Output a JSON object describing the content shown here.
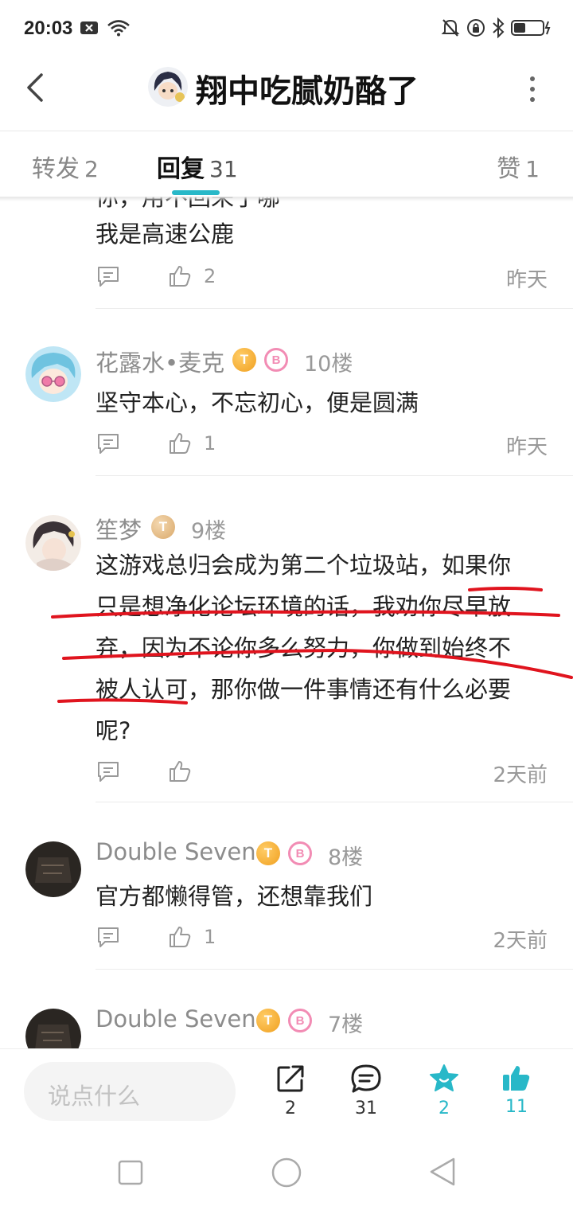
{
  "status": {
    "time": "20:03"
  },
  "header": {
    "title": "翔中吃腻奶酪了"
  },
  "tabs": [
    {
      "label": "转发",
      "count": "2"
    },
    {
      "label": "回复",
      "count": "31"
    },
    {
      "label": "赞",
      "count": "1"
    }
  ],
  "partial_top": {
    "cut_line": "你，用不回来了哪",
    "text": "我是高速公鹿",
    "likes": "2",
    "time": "昨天"
  },
  "comments": [
    {
      "user": "花露水•麦克",
      "badge_level": "5",
      "floor": "10楼",
      "lines": [
        "坚守本心，不忘初心，便是圆满"
      ],
      "likes": "1",
      "time": "昨天"
    },
    {
      "user": "笙梦",
      "badge_level": "6",
      "floor": "9楼",
      "lines": [
        "这游戏总归会成为第二个垃圾站，如果你",
        "只是想净化论坛环境的话，我劝你尽早放",
        "弃，因为不论你多么努力，你做到始终不",
        "被人认可，那你做一件事情还有什么必要",
        "呢?"
      ],
      "likes": "",
      "time": "2天前"
    },
    {
      "user": "Double Seven",
      "badge_level": "1",
      "floor": "8楼",
      "lines": [
        "官方都懒得管，还想靠我们"
      ],
      "likes": "1",
      "time": "2天前"
    },
    {
      "user": "Double Seven",
      "badge_level": "1",
      "floor": "7楼"
    }
  ],
  "bottom_bar": {
    "placeholder": "说点什么",
    "share_count": "2",
    "comment_count": "31",
    "favorite_count": "2",
    "like_count": "11"
  },
  "colors": {
    "accent": "#28b8c8",
    "annotation": "#e0141e"
  }
}
